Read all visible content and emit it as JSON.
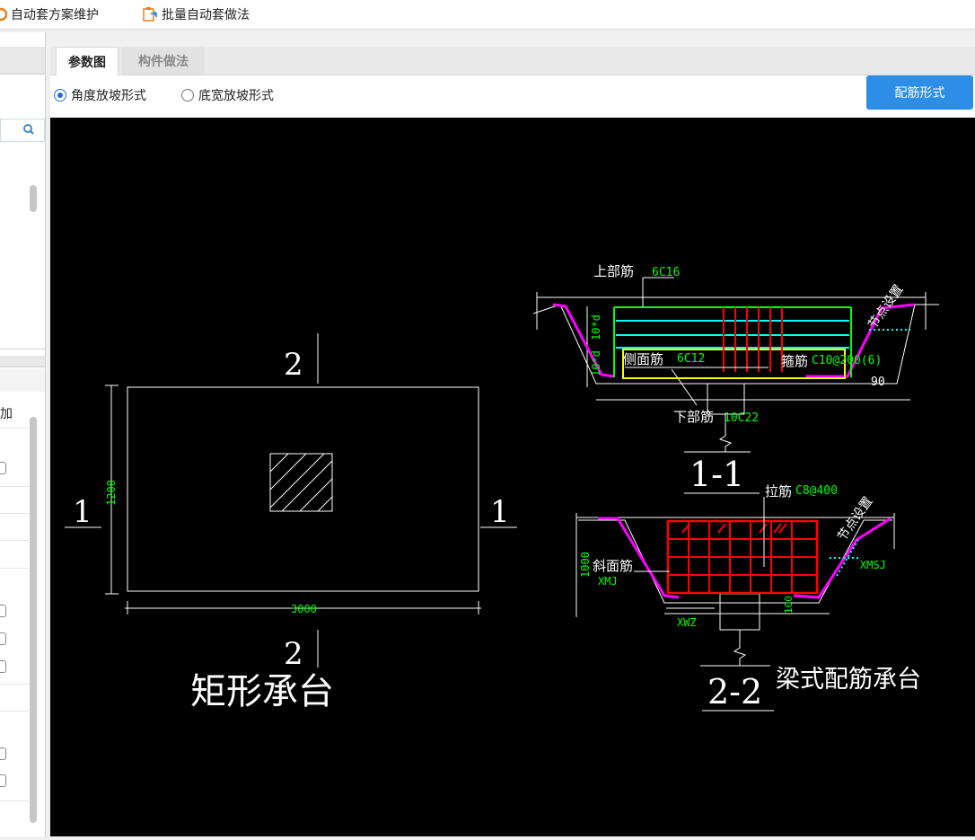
{
  "toolbar": {
    "auto_scheme_label": "自动套方案维护",
    "batch_auto_label": "批量自动套做法"
  },
  "left_panel": {
    "header_partial": "加"
  },
  "tabs": [
    {
      "label": "参数图",
      "active": true
    },
    {
      "label": "构件做法",
      "active": false
    }
  ],
  "options": {
    "radio_angle": "角度放坡形式",
    "radio_bottom": "底宽放坡形式",
    "selected": "角度放坡形式",
    "rebar_button": "配筋形式"
  },
  "drawing": {
    "rect_cap": {
      "section_top": "2",
      "section_bottom": "2",
      "section_left": "1",
      "section_right": "1",
      "dim_height": "1200",
      "dim_width": "3000",
      "title": "矩形承台"
    },
    "section11": {
      "top_rebar_label": "上部筋",
      "top_rebar_value": "6C16",
      "side_rebar_label": "侧面筋",
      "side_rebar_value": "6C12",
      "stirrup_label": "箍筋",
      "stirrup_value": "C10@200(6)",
      "bottom_rebar_label": "下部筋",
      "bottom_rebar_value": "10C22",
      "dim_left_top": "10*d",
      "dim_left_bottom": "10*d",
      "angle": "90",
      "node_setting": "节点设置",
      "title": "1-1"
    },
    "section22": {
      "tie_label": "拉筋",
      "tie_value": "C8@400",
      "slope_rebar_label": "斜面筋",
      "slope_rebar_value": "XMJ",
      "dim_height": "1000",
      "dim_side": "100",
      "xmsj": "XMSJ",
      "xwz": "XWZ",
      "node_setting": "节点设置",
      "title": "2-2",
      "caption": "梁式配筋承台"
    }
  },
  "colors": {
    "accent": "#2d8ee8",
    "cad_white": "#ffffff",
    "cad_green": "#00ff00",
    "cad_cyan": "#00ffff",
    "cad_red": "#ff0000",
    "cad_magenta": "#ff00ff",
    "cad_yellow": "#ffff00"
  }
}
